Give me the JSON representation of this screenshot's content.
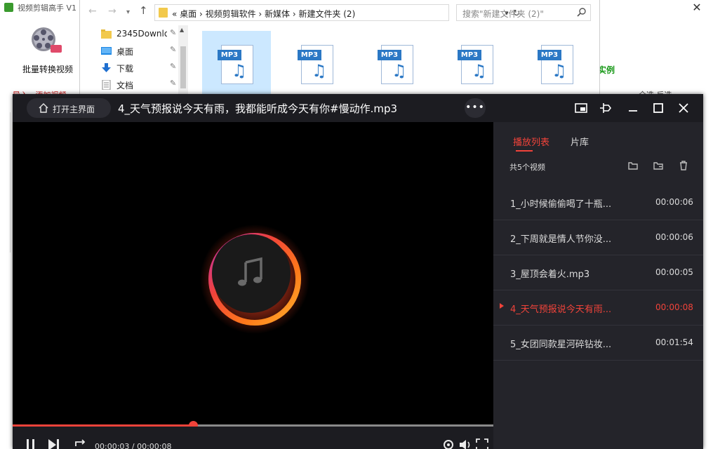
{
  "background_app": {
    "title": "视频剪辑高手 V1",
    "toolbar_label": "批量转换视频",
    "right_label": "实例",
    "red_row_text": "导入...添加视频",
    "right_row_text": "全选    反选"
  },
  "explorer": {
    "address": "« 桌面 › 视频剪辑软件 › 新媒体 › 新建文件夹 (2)",
    "search_placeholder": "搜索\"新建文件夹 (2)\"",
    "nav_items": [
      {
        "label": "2345Downlo",
        "icon": "folder-icon"
      },
      {
        "label": "桌面",
        "icon": "desktop-icon"
      },
      {
        "label": "下载",
        "icon": "download-icon"
      },
      {
        "label": "文档",
        "icon": "document-icon"
      }
    ],
    "file_tag": "MP3",
    "file_count": 5
  },
  "player": {
    "home_label": "打开主界面",
    "now_playing": "4_天气预报说今天有雨，我都能听成今天有你#慢动作.mp3",
    "more_label": "•••",
    "progress": 0.375,
    "current_time": "00:00:03",
    "total_time": "00:00:08",
    "time_text": "00:00:03 / 00:00:08",
    "colors": {
      "accent": "#f0433a",
      "background": "#1c1c21",
      "panel": "#24242a"
    }
  },
  "playlist": {
    "tabs": [
      "播放列表",
      "片库"
    ],
    "active_tab": 0,
    "count_label": "共5个视频",
    "items": [
      {
        "title": "1_小时候偷偷喝了十瓶...",
        "duration": "00:00:06",
        "active": false
      },
      {
        "title": "2_下周就是情人节你没...",
        "duration": "00:00:06",
        "active": false
      },
      {
        "title": "3_屋顶会着火.mp3",
        "duration": "00:00:05",
        "active": false
      },
      {
        "title": "4_天气预报说今天有雨...",
        "duration": "00:00:08",
        "active": true
      },
      {
        "title": "5_女团同款星河碎钻妆...",
        "duration": "00:01:54",
        "active": false
      }
    ]
  }
}
